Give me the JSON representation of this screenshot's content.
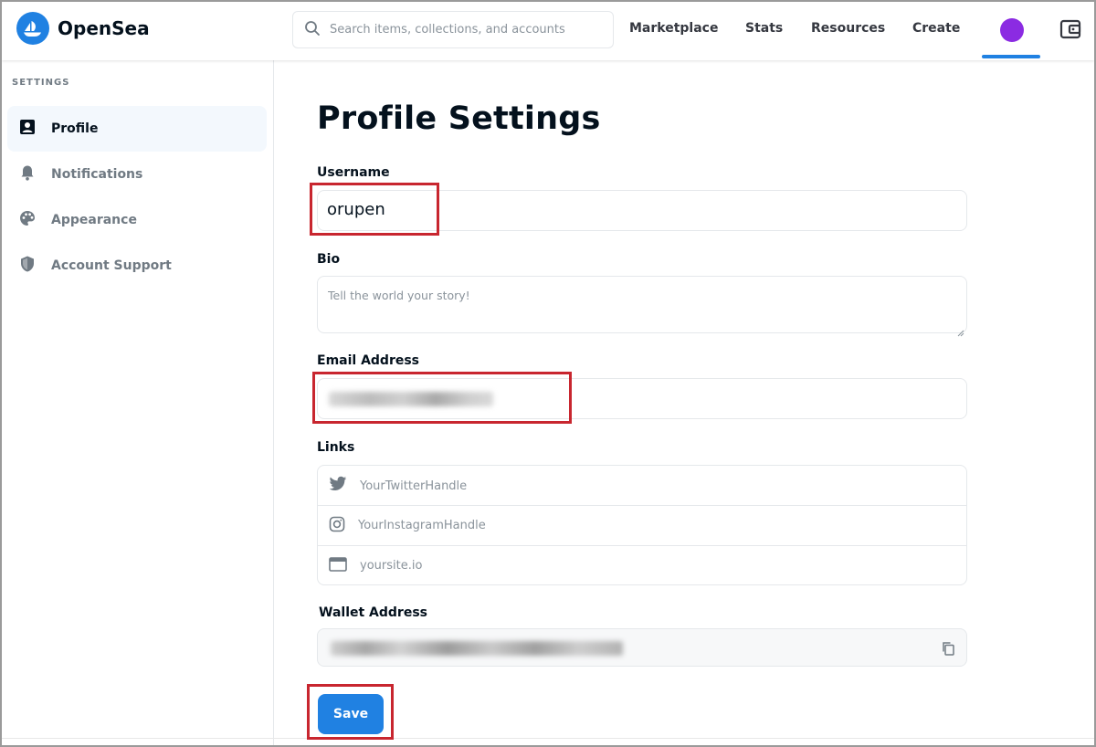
{
  "app": {
    "name": "OpenSea"
  },
  "search": {
    "placeholder": "Search items, collections, and accounts"
  },
  "nav": {
    "marketplace": "Marketplace",
    "stats": "Stats",
    "resources": "Resources",
    "create": "Create"
  },
  "sidebar": {
    "heading": "SETTINGS",
    "items": [
      {
        "label": "Profile",
        "icon": "profile-icon",
        "active": true
      },
      {
        "label": "Notifications",
        "icon": "bell-icon",
        "active": false
      },
      {
        "label": "Appearance",
        "icon": "palette-icon",
        "active": false
      },
      {
        "label": "Account Support",
        "icon": "shield-icon",
        "active": false
      }
    ]
  },
  "main": {
    "title": "Profile Settings",
    "username": {
      "label": "Username",
      "value": "orupen"
    },
    "bio": {
      "label": "Bio",
      "placeholder": "Tell the world your story!"
    },
    "email": {
      "label": "Email Address"
    },
    "links": {
      "label": "Links",
      "twitter_placeholder": "YourTwitterHandle",
      "instagram_placeholder": "YourInstagramHandle",
      "website_placeholder": "yoursite.io"
    },
    "wallet": {
      "label": "Wallet Address"
    },
    "save_label": "Save"
  },
  "colors": {
    "accent": "#2081e2",
    "avatar": "#8b2be2",
    "highlight": "#c8262f"
  }
}
